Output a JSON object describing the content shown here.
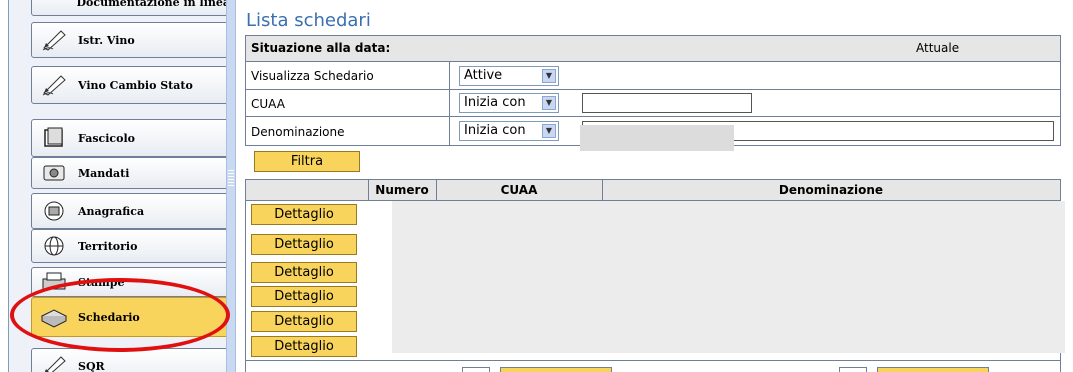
{
  "sidebar": {
    "items": [
      {
        "label": "Documentazione in linea",
        "icon": "documentation-icon"
      },
      {
        "label": "Istr. Vino",
        "icon": "pen-icon"
      },
      {
        "label": "Vino Cambio Stato",
        "icon": "pen-icon"
      },
      {
        "label": "Fascicolo",
        "icon": "folder-icon"
      },
      {
        "label": "Mandati",
        "icon": "mandates-icon"
      },
      {
        "label": "Anagrafica",
        "icon": "id-card-icon"
      },
      {
        "label": "Territorio",
        "icon": "globe-icon"
      },
      {
        "label": "Stampe",
        "icon": "printer-icon"
      },
      {
        "label": "Schedario",
        "icon": "archive-icon"
      },
      {
        "label": "SQR",
        "icon": "pen-icon"
      }
    ],
    "active": "Schedario",
    "highlight_color": "#e01010"
  },
  "main": {
    "title": "Lista schedari",
    "filters": {
      "date_label": "Situazione alla data:",
      "date_value": "Attuale",
      "schedario_label": "Visualizza Schedario",
      "schedario_value": "Attive",
      "cuaa_label": "CUAA",
      "cuaa_mode": "Inizia con",
      "cuaa_value": "",
      "denominazione_label": "Denominazione",
      "denominazione_mode": "Inizia con",
      "denominazione_value": ""
    },
    "filter_button": "Filtra",
    "table": {
      "columns": [
        "Numero",
        "CUAA",
        "Denominazione"
      ],
      "row_button": "Dettaglio",
      "rows": 6
    }
  },
  "colors": {
    "button_yellow": "#f8d45c",
    "title_blue": "#3a6fb0",
    "border": "#6f7f9a"
  }
}
